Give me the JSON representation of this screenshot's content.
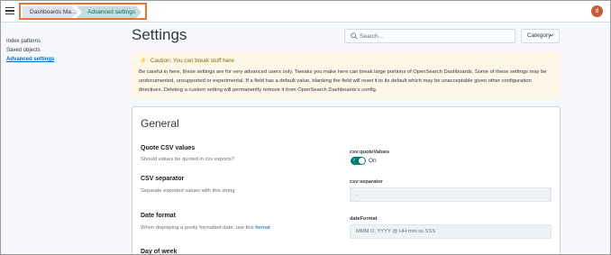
{
  "header": {
    "breadcrumbs": [
      "Dashboards Ma...",
      "Advanced settings"
    ],
    "avatar_initial": "d",
    "highlight_color": "#e8743b"
  },
  "sidebar": {
    "items": [
      {
        "label": "Index patterns",
        "active": false
      },
      {
        "label": "Saved objects",
        "active": false
      },
      {
        "label": "Advanced settings",
        "active": true
      }
    ]
  },
  "page": {
    "title": "Settings",
    "search_placeholder": "Search...",
    "category_label": "Category"
  },
  "callout": {
    "title": "Caution: You can break stuff here",
    "body": "Be careful in here, these settings are for very advanced users only. Tweaks you make here can break large portions of OpenSearch Dashboards. Some of these settings may be undocumented, unsupported or experimental. If a field has a default value, blanking the field will reset it to its default which may be unacceptable given other configuration directives. Deleting a custom setting will permanently remove it from OpenSearch Dashboards's config."
  },
  "general": {
    "title": "General",
    "settings": [
      {
        "title": "Quote CSV values",
        "description": "Should values be quoted in csv exports?",
        "field_label": "csv:quoteValues",
        "toggle_on": true,
        "toggle_text": "On"
      },
      {
        "title": "CSV separator",
        "description": "Separate exported values with this string",
        "field_label": "csv:separator",
        "value": ","
      },
      {
        "title": "Date format",
        "description_prefix": "When displaying a pretty formatted date, use this ",
        "description_link": "format",
        "field_label": "dateFormat",
        "value": "MMM D, YYYY @ HH:mm:ss.SSS"
      },
      {
        "title": "Day of week"
      }
    ]
  }
}
